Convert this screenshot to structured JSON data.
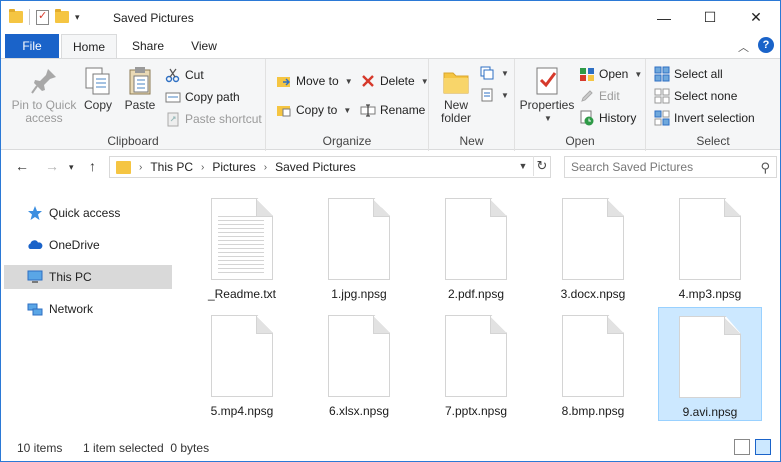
{
  "window": {
    "title": "Saved Pictures",
    "controls": {
      "minimize": "—",
      "maximize": "☐",
      "close": "✕"
    }
  },
  "ribbon_tabs": {
    "file": "File",
    "tabs": [
      "Home",
      "Share",
      "View"
    ],
    "active": "Home"
  },
  "ribbon": {
    "clipboard": {
      "label": "Clipboard",
      "pin": "Pin to Quick access",
      "copy": "Copy",
      "paste": "Paste",
      "cut": "Cut",
      "copy_path": "Copy path",
      "paste_shortcut": "Paste shortcut"
    },
    "organize": {
      "label": "Organize",
      "move_to": "Move to",
      "copy_to": "Copy to",
      "delete": "Delete",
      "rename": "Rename"
    },
    "new": {
      "label": "New",
      "new_folder": "New folder"
    },
    "open": {
      "label": "Open",
      "properties": "Properties",
      "open": "Open",
      "edit": "Edit",
      "history": "History"
    },
    "select": {
      "label": "Select",
      "select_all": "Select all",
      "select_none": "Select none",
      "invert": "Invert selection"
    }
  },
  "address": {
    "crumbs": [
      "This PC",
      "Pictures",
      "Saved Pictures"
    ],
    "search_placeholder": "Search Saved Pictures"
  },
  "nav_pane": {
    "items": [
      "Quick access",
      "OneDrive",
      "This PC",
      "Network"
    ],
    "selected": "This PC"
  },
  "files": [
    {
      "name": "_Readme.txt",
      "type": "text"
    },
    {
      "name": "1.jpg.npsg",
      "type": "blank"
    },
    {
      "name": "2.pdf.npsg",
      "type": "blank"
    },
    {
      "name": "3.docx.npsg",
      "type": "blank"
    },
    {
      "name": "4.mp3.npsg",
      "type": "blank"
    },
    {
      "name": "5.mp4.npsg",
      "type": "blank"
    },
    {
      "name": "6.xlsx.npsg",
      "type": "blank"
    },
    {
      "name": "7.pptx.npsg",
      "type": "blank"
    },
    {
      "name": "8.bmp.npsg",
      "type": "blank"
    },
    {
      "name": "9.avi.npsg",
      "type": "blank",
      "selected": true
    }
  ],
  "status": {
    "count": "10 items",
    "selection": "1 item selected  0 bytes"
  },
  "colors": {
    "accent": "#1a63c9",
    "selection": "#cce8ff",
    "nav_selected": "#d9d9d9"
  }
}
